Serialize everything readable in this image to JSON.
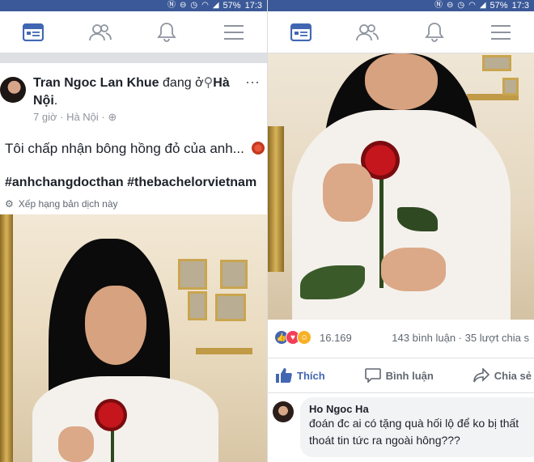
{
  "status": {
    "battery": "57%",
    "time": "17:3"
  },
  "nav": {
    "icons": [
      "news-feed-icon",
      "friends-icon",
      "notifications-icon",
      "menu-icon"
    ]
  },
  "post": {
    "author": "Tran Ngoc Lan Khue",
    "location_prefix": "đang ở",
    "location": "Hà Nội",
    "time_ago": "7 giờ",
    "place": "Hà Nội",
    "text": "Tôi chấp nhận bông hồng đỏ của anh...",
    "hashtags": "#anhchangdocthan #thebachelorvietnam",
    "rate_translation": "Xếp hạng bản dịch này"
  },
  "engagement": {
    "reactions_count": "16.169",
    "comments": "143 bình luận",
    "shares": "35 lượt chia s"
  },
  "actions": {
    "like": "Thích",
    "comment": "Bình luận",
    "share": "Chia sẻ"
  },
  "comment": {
    "author": "Ho Ngoc Ha",
    "text": "đoán đc ai có tặng quà hối lộ để ko bị thất thoát tin tức ra ngoài hông???"
  },
  "colors": {
    "fb_blue": "#3b5998",
    "like_blue": "#4267b2",
    "meta_gray": "#90949c"
  }
}
